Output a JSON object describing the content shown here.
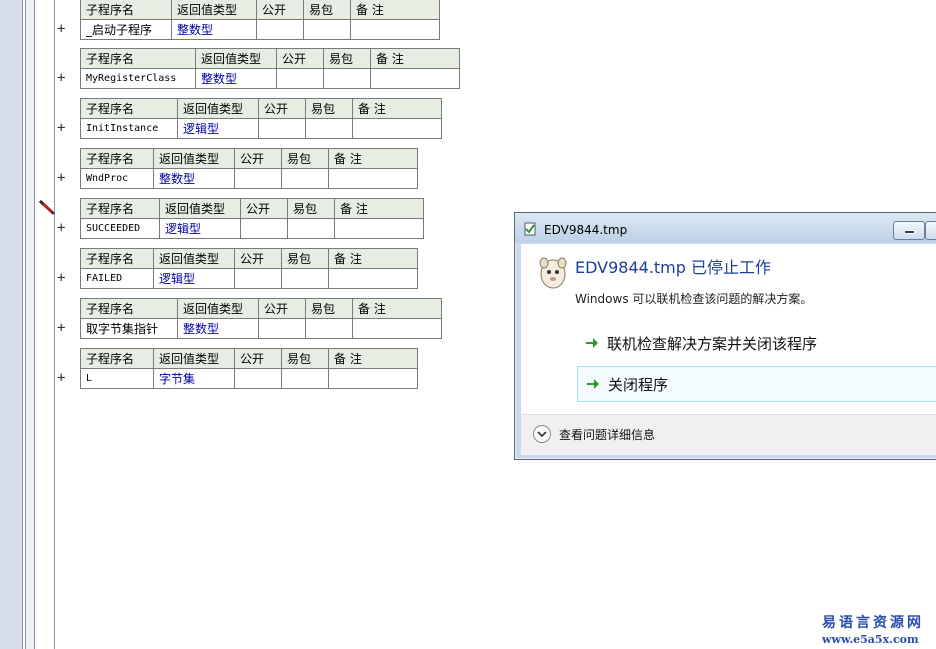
{
  "headers": {
    "name": "子程序名",
    "return_type": "返回值类型",
    "public": "公开",
    "easy_pack": "易包",
    "note": "备 注"
  },
  "expand_glyph": "+",
  "subroutines": [
    {
      "name": "_启动子程序",
      "return_type": "整数型"
    },
    {
      "name": "MyRegisterClass",
      "return_type": "整数型"
    },
    {
      "name": "InitInstance",
      "return_type": "逻辑型"
    },
    {
      "name": "WndProc",
      "return_type": "整数型"
    },
    {
      "name": "SUCCEEDED",
      "return_type": "逻辑型"
    },
    {
      "name": "FAILED",
      "return_type": "逻辑型"
    },
    {
      "name": "取字节集指针",
      "return_type": "整数型"
    },
    {
      "name": "L",
      "return_type": "字节集"
    }
  ],
  "dialog": {
    "title": "EDV9844.tmp",
    "heading": "EDV9844.tmp 已停止工作",
    "message": "Windows 可以联机检查该问题的解决方案。",
    "option_check_online": "联机检查解决方案并关闭该程序",
    "option_close": "关闭程序",
    "details_toggle": "查看问题详细信息"
  },
  "watermark": {
    "site_name": "易语言资源网",
    "url": "www.e5a5x.com"
  },
  "colors": {
    "header_bg": "#e6eee4",
    "type_text": "#0000a0",
    "dialog_heading": "#1b3f9c",
    "arrow_green": "#2e9a2e"
  },
  "icons": {
    "pencil": "pencil-icon",
    "expand": "plus-icon",
    "dialog_app": "app-icon",
    "arrow": "green-arrow-icon",
    "details": "chevron-down-icon"
  }
}
